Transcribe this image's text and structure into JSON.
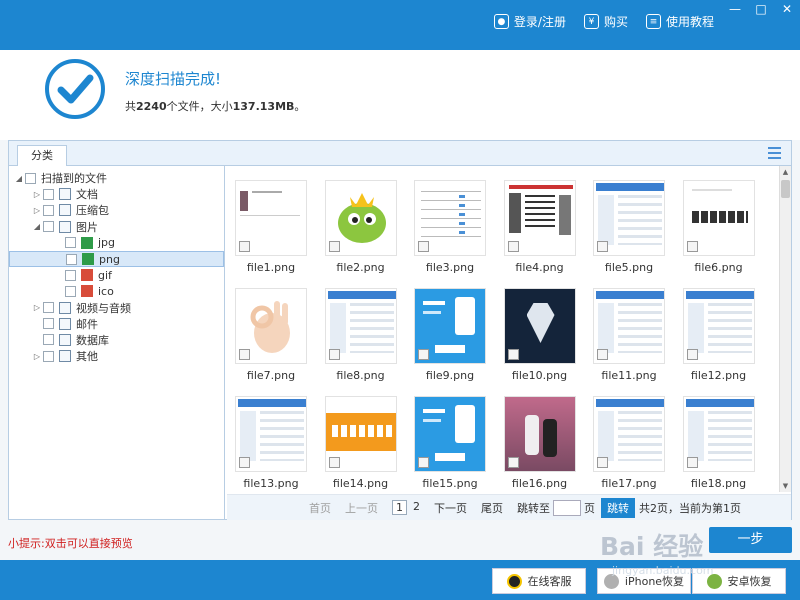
{
  "titlebar": {
    "links": [
      {
        "label": "登录/注册",
        "icon": "user-icon"
      },
      {
        "label": "购买",
        "icon": "yen-icon"
      },
      {
        "label": "使用教程",
        "icon": "book-icon"
      }
    ],
    "controls": [
      "minimize-icon",
      "maximize-icon",
      "close-icon"
    ]
  },
  "header": {
    "title": "深度扫描完成!",
    "summary_prefix": "共",
    "file_count": "2240",
    "summary_mid": "个文件，大小",
    "total_size": "137.13MB",
    "summary_suffix": "。"
  },
  "tabs": {
    "category": "分类"
  },
  "tree": {
    "root": "扫描到的文件",
    "items": [
      {
        "label": "文档",
        "level": 1,
        "expandable": true
      },
      {
        "label": "压缩包",
        "level": 1,
        "expandable": true
      },
      {
        "label": "图片",
        "level": 1,
        "expandable": true,
        "expanded": true
      },
      {
        "label": "jpg",
        "level": 2,
        "icon_color": "#2e9b48"
      },
      {
        "label": "png",
        "level": 2,
        "icon_color": "#2e9b48",
        "selected": true
      },
      {
        "label": "gif",
        "level": 2,
        "icon_color": "#d84c3a"
      },
      {
        "label": "ico",
        "level": 2,
        "icon_color": "#d84c3a"
      },
      {
        "label": "视频与音频",
        "level": 1,
        "expandable": true
      },
      {
        "label": "邮件",
        "level": 1
      },
      {
        "label": "数据库",
        "level": 1
      },
      {
        "label": "其他",
        "level": 1,
        "expandable": true
      }
    ]
  },
  "files": [
    {
      "name": "file1.png",
      "kind": "doc"
    },
    {
      "name": "file2.png",
      "kind": "cartoon"
    },
    {
      "name": "file3.png",
      "kind": "form"
    },
    {
      "name": "file4.png",
      "kind": "collage"
    },
    {
      "name": "file5.png",
      "kind": "screenshot"
    },
    {
      "name": "file6.png",
      "kind": "text"
    },
    {
      "name": "file7.png",
      "kind": "hand"
    },
    {
      "name": "file8.png",
      "kind": "screenshot"
    },
    {
      "name": "file9.png",
      "kind": "phone"
    },
    {
      "name": "file10.png",
      "kind": "dark"
    },
    {
      "name": "file11.png",
      "kind": "screenshot"
    },
    {
      "name": "file12.png",
      "kind": "screenshot"
    },
    {
      "name": "file13.png",
      "kind": "screenshot"
    },
    {
      "name": "file14.png",
      "kind": "banner"
    },
    {
      "name": "file15.png",
      "kind": "phone"
    },
    {
      "name": "file16.png",
      "kind": "photo"
    },
    {
      "name": "file17.png",
      "kind": "screenshot"
    },
    {
      "name": "file18.png",
      "kind": "screenshot"
    }
  ],
  "pager": {
    "first": "首页",
    "prev": "上一页",
    "pages": [
      "1",
      "2"
    ],
    "next": "下一页",
    "last": "尾页",
    "goto_label": "跳转至",
    "page_unit": "页",
    "go_button": "跳转",
    "status": "共2页，当前为第1页"
  },
  "tip": "小提示:双击可以直接预览",
  "next_button": "一步",
  "footer": {
    "buttons": [
      {
        "label": "在线客服",
        "icon": "qq-icon"
      },
      {
        "label": "iPhone恢复",
        "icon": "apple-icon"
      },
      {
        "label": "安卓恢复",
        "icon": "android-icon"
      }
    ]
  },
  "watermark": {
    "main": "Bai 经验",
    "sub": "jingyan.baidu.com"
  },
  "colors": {
    "accent": "#1d86d0",
    "tip": "#d02020"
  }
}
